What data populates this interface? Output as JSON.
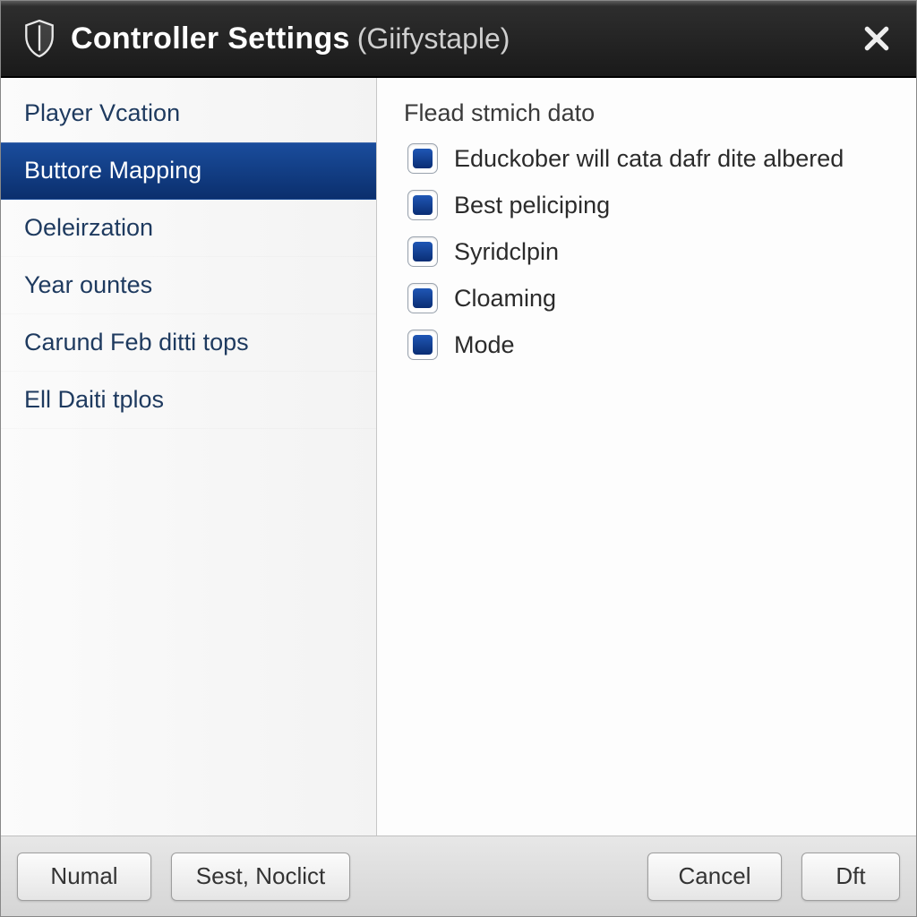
{
  "colors": {
    "accent": "#123d87",
    "titlebar_bg": "#222222",
    "window_bg": "#fdfdfd"
  },
  "titlebar": {
    "title": "Controller Settings",
    "subtitle": "(Giifystaple)",
    "icon_name": "shield-icon"
  },
  "sidebar": {
    "items": [
      {
        "label": "Player Vcation",
        "selected": false
      },
      {
        "label": "Buttore Mapping",
        "selected": true
      },
      {
        "label": "Oeleirzation",
        "selected": false
      },
      {
        "label": "Year ountes",
        "selected": false
      },
      {
        "label": "Carund Feb ditti tops",
        "selected": false
      },
      {
        "label": "Ell Daiti tplos",
        "selected": false
      }
    ]
  },
  "content": {
    "header": "Flead stmich dato",
    "options": [
      {
        "label": "Educkober will cata dafr dite albered",
        "checked": true
      },
      {
        "label": "Best peliciping",
        "checked": true
      },
      {
        "label": "Syridclpin",
        "checked": true
      },
      {
        "label": "Cloaming",
        "checked": true
      },
      {
        "label": "Mode",
        "checked": true
      }
    ]
  },
  "footer": {
    "btn_left1": "Numal",
    "btn_left2": "Sest, Noclict",
    "btn_cancel": "Cancel",
    "btn_ok": "Dft"
  }
}
